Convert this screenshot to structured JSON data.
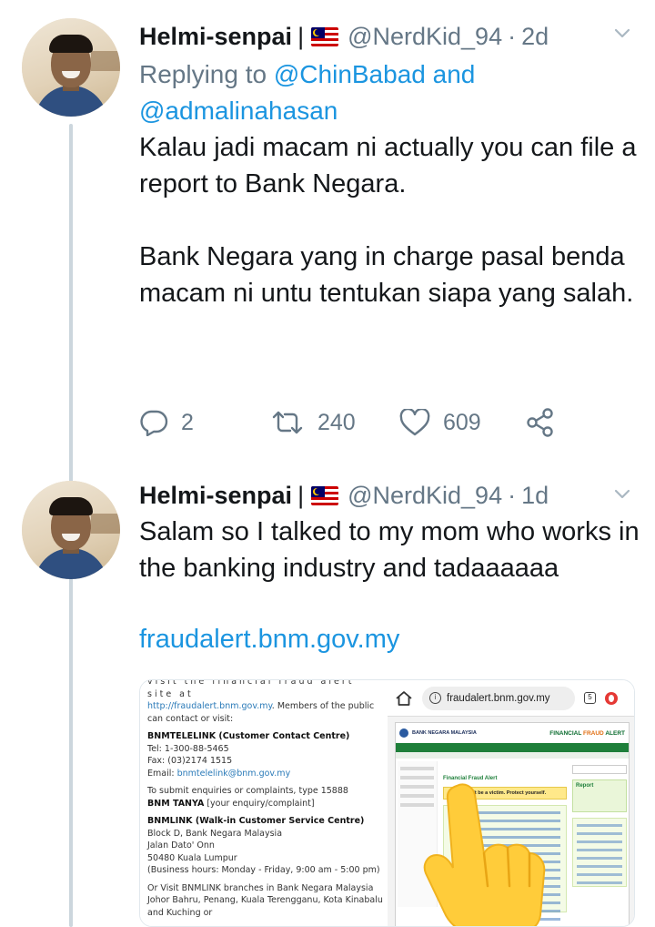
{
  "tweets": [
    {
      "author": {
        "name": "Helmi-senpai",
        "separator": "|",
        "handle": "@NerdKid_94",
        "time_sep": "·",
        "time": "2d"
      },
      "replying_to": {
        "prefix": "Replying to",
        "mention1": "@ChinBabad",
        "conjunction": "and",
        "mention2": "@admalinahasan"
      },
      "paragraphs": [
        "Kalau jadi macam ni actually you can file a report to Bank Negara.",
        "Bank Negara yang in charge pasal benda macam ni untu tentukan siapa yang salah."
      ],
      "actions": {
        "replies": "2",
        "retweets": "240",
        "likes": "609"
      }
    },
    {
      "author": {
        "name": "Helmi-senpai",
        "separator": "|",
        "handle": "@NerdKid_94",
        "time_sep": "·",
        "time": "1d"
      },
      "paragraphs": [
        "Salam so I talked to my mom who works in the banking industry and tadaaaaaa"
      ],
      "link": "fraudalert.bnm.gov.my",
      "media": {
        "document": {
          "cut_top": "visit the financial fraud alert site at",
          "url": "http://fraudalert.bnm.gov.my",
          "intro": ". Members of the public can contact or visit:",
          "telelink_title": "BNMTELELINK (Customer Contact Centre)",
          "tel": "Tel: 1-300-88-5465",
          "fax": "Fax: (03)2174 1515",
          "email_label": "Email: ",
          "email": "bnmtelelink@bnm.gov.my",
          "sms_line": "To submit enquiries or complaints, type 15888",
          "sms_code": "BNM TANYA",
          "sms_tail": " [your enquiry/complaint]",
          "bnmlink_title": "BNMLINK (Walk-in Customer Service Centre)",
          "addr1": "Block D, Bank Negara Malaysia",
          "addr2": "Jalan Dato' Onn",
          "addr3": "50480 Kuala Lumpur",
          "hours": "(Business hours: Monday - Friday, 9:00 am - 5:00 pm)",
          "branches": "Or Visit BNMLINK branches in Bank Negara Malaysia Johor Bahru, Penang, Kuala Terengganu, Kota Kinabalu and Kuching or"
        },
        "screenshot": {
          "url": "fraudalert.bnm.gov.my",
          "tab_count": "5",
          "site_name": "BANK NEGARA MALAYSIA",
          "site_title_a": "FINANCIAL",
          "site_title_b": " FRAUD ",
          "site_title_c": "ALERT",
          "section_heading": "Financial Fraud Alert",
          "banner": "Don't be a victim. Protect yourself.",
          "report_label": "Report"
        }
      }
    }
  ],
  "colors": {
    "link": "#1b95e0",
    "muted": "#657786",
    "text": "#14171a",
    "thread_line": "#ccd6dd"
  },
  "icons": [
    "reply-icon",
    "retweet-icon",
    "like-icon",
    "share-icon",
    "chevron-down-icon",
    "malaysia-flag-icon",
    "home-icon",
    "info-icon",
    "tabs-icon",
    "opera-icon",
    "pointing-hand-emoji"
  ]
}
